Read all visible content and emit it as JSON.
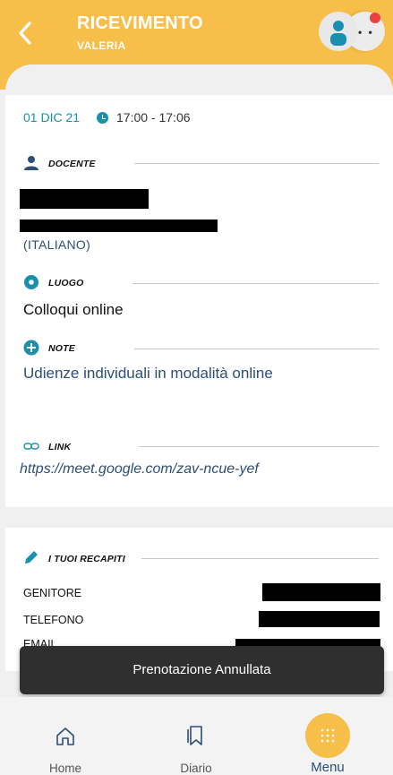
{
  "header": {
    "title": "RICEVIMENTO",
    "subtitle": "VALERIA"
  },
  "colors": {
    "accent": "#f8be4a",
    "link": "#2d4e78",
    "date": "#1b8fb0",
    "notification": "#e94040"
  },
  "appointment": {
    "date": "01 DIC 21",
    "time": "17:00 - 17:06"
  },
  "teacher": {
    "section_label": "DOCENTE",
    "subject": "(ITALIANO)"
  },
  "location": {
    "section_label": "LUOGO",
    "value": "Colloqui online"
  },
  "notes": {
    "section_label": "NOTE",
    "value": "Udienze individuali in modalità online"
  },
  "link": {
    "section_label": "LINK",
    "value": "https://meet.google.com/zav-ncue-yef"
  },
  "contacts": {
    "section_label": "I TUOI RECAPITI",
    "rows": [
      "GENITORE",
      "TELEFONO",
      "EMAIL"
    ]
  },
  "toast": {
    "message": "Prenotazione Annullata"
  },
  "bottom_nav": {
    "items": [
      {
        "label": "Home",
        "icon": "home-icon"
      },
      {
        "label": "Diario",
        "icon": "bookmark-icon"
      },
      {
        "label": "Menu",
        "icon": "dots-grid-icon"
      }
    ]
  }
}
